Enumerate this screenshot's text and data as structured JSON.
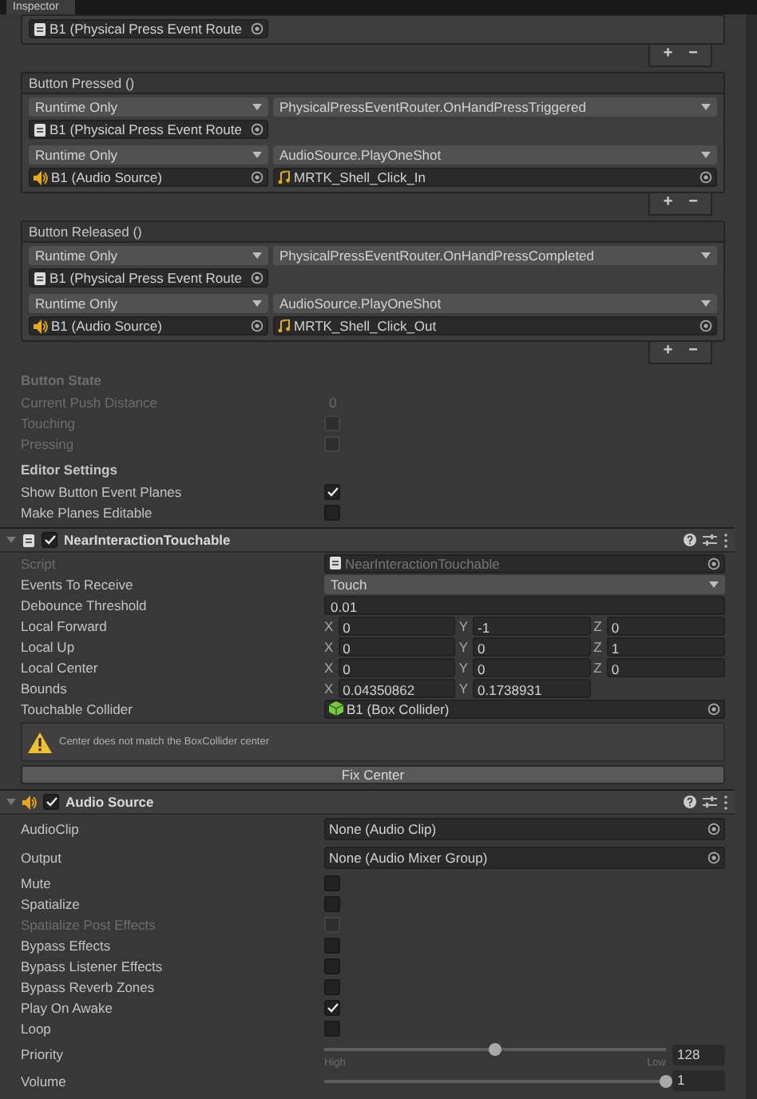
{
  "tab": {
    "label": "Inspector"
  },
  "top_event": {
    "listeners": [
      {
        "target": "B1 (Physical Press Event Route"
      }
    ],
    "footer": [
      "+",
      "−"
    ]
  },
  "events": [
    {
      "title": "Button Pressed ()",
      "footer": [
        "+",
        "−"
      ],
      "listeners": [
        {
          "mode": "Runtime Only",
          "function": "PhysicalPressEventRouter.OnHandPressTriggered",
          "target": "B1 (Physical Press Event Route"
        },
        {
          "mode": "Runtime Only",
          "function": "AudioSource.PlayOneShot",
          "target": "B1 (Audio Source)",
          "argument": "MRTK_Shell_Click_In"
        }
      ]
    },
    {
      "title": "Button Released ()",
      "footer": [
        "+",
        "−"
      ],
      "listeners": [
        {
          "mode": "Runtime Only",
          "function": "PhysicalPressEventRouter.OnHandPressCompleted",
          "target": "B1 (Physical Press Event Route"
        },
        {
          "mode": "Runtime Only",
          "function": "AudioSource.PlayOneShot",
          "target": "B1 (Audio Source)",
          "argument": "MRTK_Shell_Click_Out"
        }
      ]
    }
  ],
  "sections": [
    {
      "title": "Button State",
      "disabled": true,
      "fields": [
        {
          "kind": "text",
          "label": "Current Push Distance",
          "value": "0",
          "disabled": true
        },
        {
          "kind": "toggle",
          "label": "Touching",
          "checked": false,
          "disabled": true
        },
        {
          "kind": "toggle",
          "label": "Pressing",
          "checked": false,
          "disabled": true
        }
      ]
    },
    {
      "title": "Editor Settings",
      "disabled": false,
      "fields": [
        {
          "kind": "toggle",
          "label": "Show Button Event Planes",
          "checked": true,
          "disabled": false
        },
        {
          "kind": "toggle",
          "label": "Make Planes Editable",
          "checked": false,
          "disabled": false
        }
      ]
    }
  ],
  "components": [
    {
      "title": "NearInteractionTouchable",
      "enabled": true,
      "expanded": true,
      "fields": [
        {
          "kind": "script_field",
          "label": "Script",
          "value": "NearInteractionTouchable",
          "disabled": true
        },
        {
          "kind": "dropdown",
          "label": "Events To Receive",
          "value": "Touch"
        },
        {
          "kind": "text",
          "label": "Debounce Threshold",
          "value": "0.01"
        },
        {
          "kind": "vector",
          "label": "Local Forward",
          "axes": [
            {
              "axis": "X",
              "value": "0"
            },
            {
              "axis": "Y",
              "value": "-1"
            },
            {
              "axis": "Z",
              "value": "0"
            }
          ]
        },
        {
          "kind": "vector",
          "label": "Local Up",
          "axes": [
            {
              "axis": "X",
              "value": "0"
            },
            {
              "axis": "Y",
              "value": "0"
            },
            {
              "axis": "Z",
              "value": "1"
            }
          ]
        },
        {
          "kind": "vector",
          "label": "Local Center",
          "axes": [
            {
              "axis": "X",
              "value": "0"
            },
            {
              "axis": "Y",
              "value": "0"
            },
            {
              "axis": "Z",
              "value": "0"
            }
          ]
        },
        {
          "kind": "vector",
          "label": "Bounds",
          "axes": [
            {
              "axis": "X",
              "value": "0.04350862"
            },
            {
              "axis": "Y",
              "value": "0.1738931"
            }
          ]
        },
        {
          "kind": "collider_field",
          "label": "Touchable Collider",
          "value": "B1 (Box Collider)"
        },
        {
          "kind": "warning",
          "message": "Center does not match the BoxCollider center"
        },
        {
          "kind": "button",
          "label": "Fix Center"
        }
      ]
    },
    {
      "title": "Audio Source",
      "enabled": true,
      "expanded": true,
      "fields": [
        {
          "kind": "asset_field",
          "label": "AudioClip",
          "value": "None (Audio Clip)"
        },
        {
          "kind": "asset_field",
          "label": "Output",
          "value": "None (Audio Mixer Group)"
        },
        {
          "kind": "toggle",
          "label": "Mute",
          "checked": false,
          "disabled": false
        },
        {
          "kind": "toggle",
          "label": "Spatialize",
          "checked": false,
          "disabled": false
        },
        {
          "kind": "toggle",
          "label": "Spatialize Post Effects",
          "checked": false,
          "disabled": true
        },
        {
          "kind": "toggle",
          "label": "Bypass Effects",
          "checked": false,
          "disabled": false
        },
        {
          "kind": "toggle",
          "label": "Bypass Listener Effects",
          "checked": false,
          "disabled": false
        },
        {
          "kind": "toggle",
          "label": "Bypass Reverb Zones",
          "checked": false,
          "disabled": false
        },
        {
          "kind": "toggle",
          "label": "Play On Awake",
          "checked": true,
          "disabled": false
        },
        {
          "kind": "toggle",
          "label": "Loop",
          "checked": false,
          "disabled": false
        },
        {
          "kind": "slider",
          "label": "Priority",
          "level": 0.5,
          "value": "128",
          "low_label": "High",
          "high_label": "Low"
        },
        {
          "kind": "slider",
          "label": "Volume",
          "level": 1,
          "value": "1"
        }
      ]
    }
  ]
}
